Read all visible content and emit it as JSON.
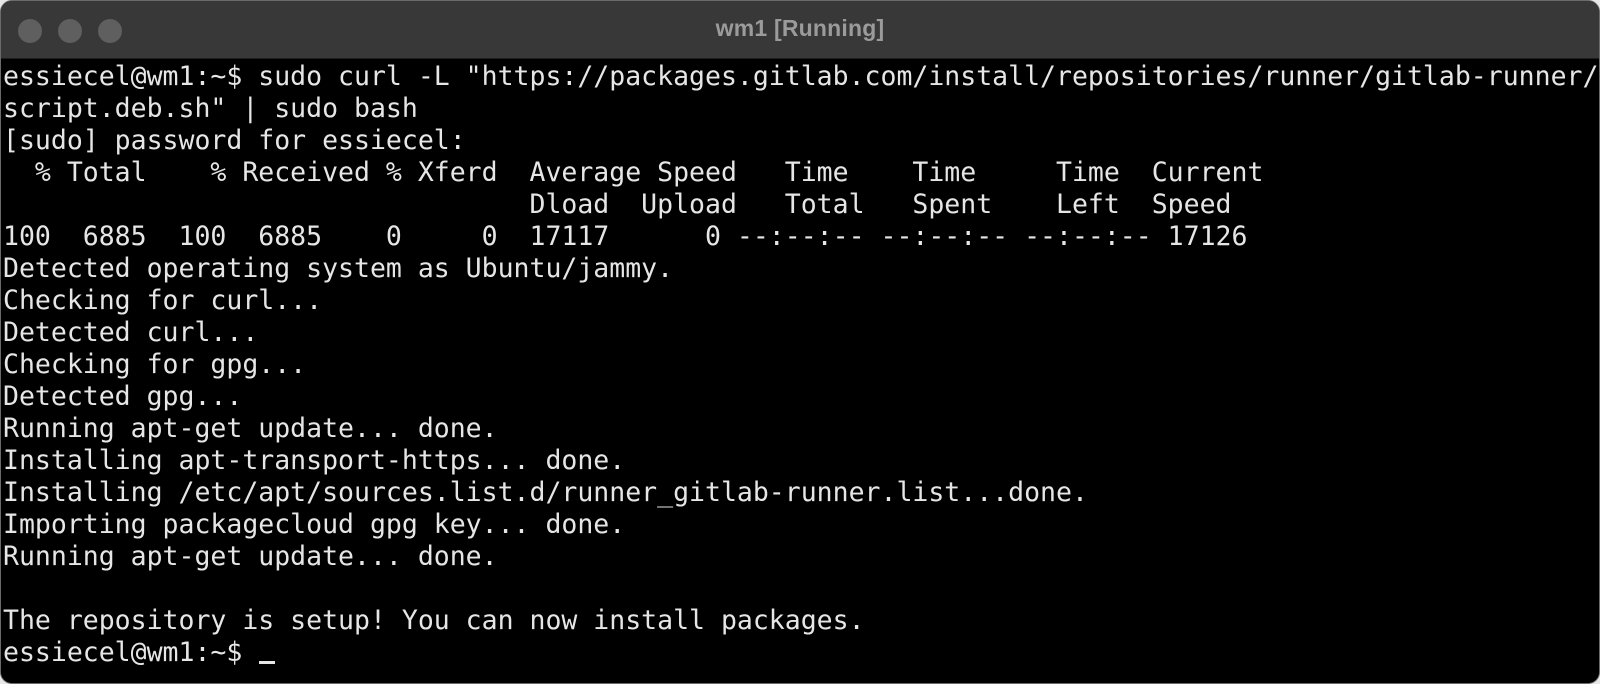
{
  "window": {
    "title": "wm1 [Running]"
  },
  "terminal": {
    "lines": [
      "essiecel@wm1:~$ sudo curl -L \"https://packages.gitlab.com/install/repositories/runner/gitlab-runner/",
      "script.deb.sh\" | sudo bash",
      "[sudo] password for essiecel:",
      "  % Total    % Received % Xferd  Average Speed   Time    Time     Time  Current",
      "                                 Dload  Upload   Total   Spent    Left  Speed",
      "100  6885  100  6885    0     0  17117      0 --:--:-- --:--:-- --:--:-- 17126",
      "Detected operating system as Ubuntu/jammy.",
      "Checking for curl...",
      "Detected curl...",
      "Checking for gpg...",
      "Detected gpg...",
      "Running apt-get update... done.",
      "Installing apt-transport-https... done.",
      "Installing /etc/apt/sources.list.d/runner_gitlab-runner.list...done.",
      "Importing packagecloud gpg key... done.",
      "Running apt-get update... done.",
      "",
      "The repository is setup! You can now install packages."
    ],
    "prompt": "essiecel@wm1:~$ "
  }
}
